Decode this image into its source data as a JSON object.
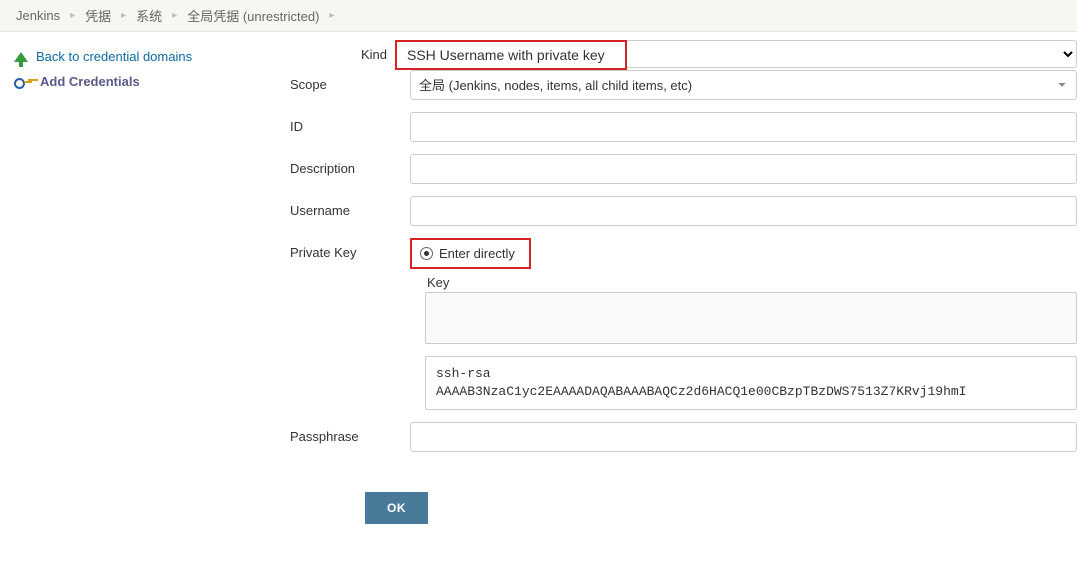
{
  "breadcrumb": {
    "items": [
      "Jenkins",
      "凭据",
      "系统",
      "全局凭据 (unrestricted)"
    ]
  },
  "sidebar": {
    "back": "Back to credential domains",
    "add": "Add Credentials"
  },
  "form": {
    "kind_label": "Kind",
    "kind_value": "SSH Username with private key",
    "scope_label": "Scope",
    "scope_value": "全局 (Jenkins, nodes, items, all child items, etc)",
    "id_label": "ID",
    "id_value": "",
    "description_label": "Description",
    "description_value": "",
    "username_label": "Username",
    "username_value": "",
    "private_key_label": "Private Key",
    "enter_directly": "Enter directly",
    "key_label": "Key",
    "key_content": "ssh-rsa\nAAAAB3NzaC1yc2EAAAADAQABAAABAQCz2d6HACQ1e00CBzpTBzDWS7513Z7KRvj19hmI",
    "passphrase_label": "Passphrase",
    "passphrase_value": "",
    "ok_button": "OK"
  }
}
